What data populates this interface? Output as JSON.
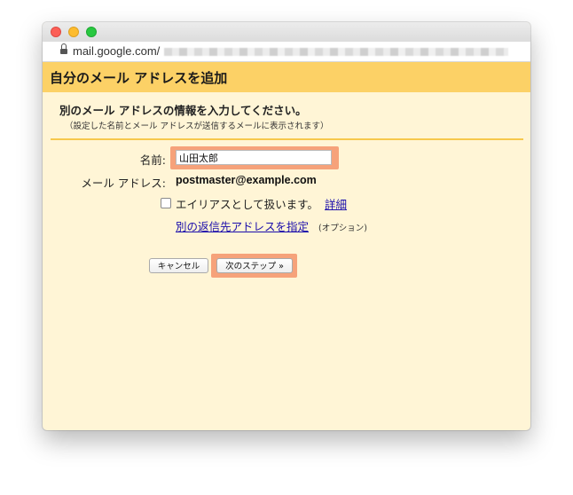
{
  "browser": {
    "url": "mail.google.com/"
  },
  "dialog": {
    "title": "自分のメール アドレスを追加",
    "heading": "別のメール アドレスの情報を入力してください。",
    "subtext": "（設定した名前とメール アドレスが送信するメールに表示されます）",
    "name_label": "名前:",
    "name_value": "山田太郎",
    "email_label": "メール アドレス:",
    "email_value": "postmaster@example.com",
    "alias_checkbox_label": "エイリアスとして扱います。",
    "alias_details_link": "詳細",
    "reply_to_link": "別の返信先アドレスを指定",
    "reply_to_optional": "(オプション)",
    "cancel_button": "キャンセル",
    "next_button": "次のステップ »"
  },
  "colors": {
    "header": "#fcd166",
    "background": "#fff5d6",
    "highlight": "#f6a27a",
    "link": "#1a0dab"
  }
}
